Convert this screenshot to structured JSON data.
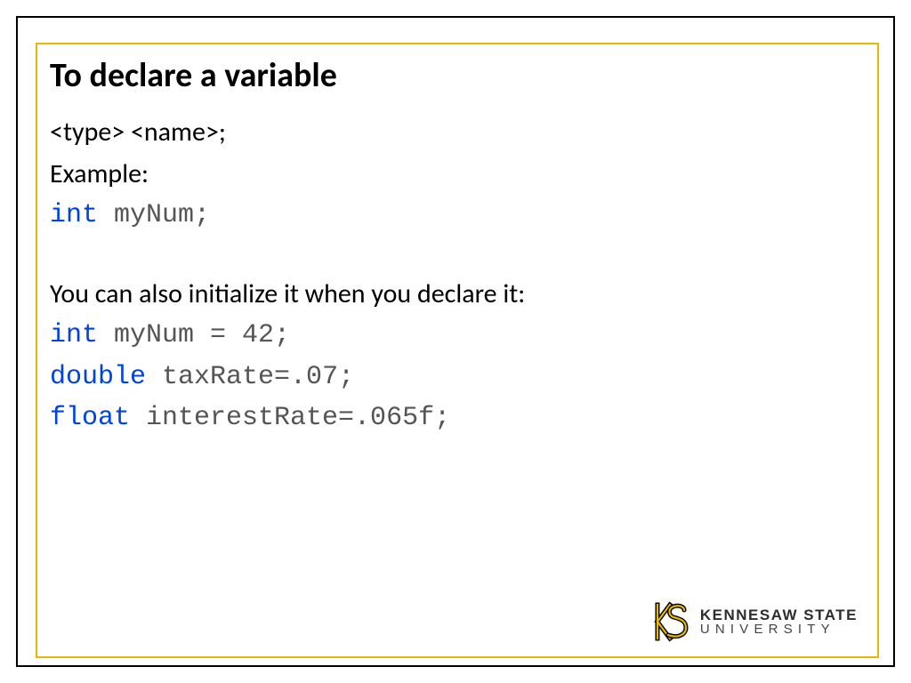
{
  "title": "To declare a variable",
  "syntax": "<type> <name>;",
  "example_label": "Example:",
  "example1": {
    "kw": "int",
    "rest": " myNum;"
  },
  "init_label": "You can also initialize it when you declare it:",
  "init1": {
    "kw": "int",
    "rest": " myNum = 42;"
  },
  "init2": {
    "kw": "double",
    "rest": " taxRate=.07;"
  },
  "init3": {
    "kw": "float",
    "rest": " interestRate=.065f;"
  },
  "logo": {
    "line1": "KENNESAW STATE",
    "line2": "UNIVERSITY"
  }
}
